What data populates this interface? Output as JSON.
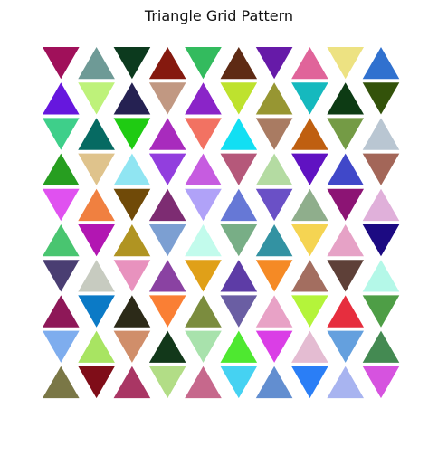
{
  "chart_data": {
    "type": "other",
    "title": "Triangle Grid Pattern",
    "grid": false,
    "axes_visible": false,
    "triangles": [
      {
        "row": 0,
        "col": 0,
        "orientation": "down",
        "color": "#a0105a"
      },
      {
        "row": 0,
        "col": 1,
        "orientation": "up",
        "color": "#6e9a96"
      },
      {
        "row": 0,
        "col": 2,
        "orientation": "down",
        "color": "#0c3a1e"
      },
      {
        "row": 0,
        "col": 3,
        "orientation": "up",
        "color": "#85190f"
      },
      {
        "row": 0,
        "col": 4,
        "orientation": "down",
        "color": "#33bb5e"
      },
      {
        "row": 0,
        "col": 5,
        "orientation": "up",
        "color": "#5e2a14"
      },
      {
        "row": 0,
        "col": 6,
        "orientation": "down",
        "color": "#661aa8"
      },
      {
        "row": 0,
        "col": 7,
        "orientation": "up",
        "color": "#e0649a"
      },
      {
        "row": 0,
        "col": 8,
        "orientation": "down",
        "color": "#ede282"
      },
      {
        "row": 0,
        "col": 9,
        "orientation": "up",
        "color": "#3071cf"
      },
      {
        "row": 1,
        "col": 0,
        "orientation": "up",
        "color": "#6617de"
      },
      {
        "row": 1,
        "col": 1,
        "orientation": "down",
        "color": "#bef27a"
      },
      {
        "row": 1,
        "col": 2,
        "orientation": "up",
        "color": "#252152"
      },
      {
        "row": 1,
        "col": 3,
        "orientation": "down",
        "color": "#c19882"
      },
      {
        "row": 1,
        "col": 4,
        "orientation": "up",
        "color": "#8a24c8"
      },
      {
        "row": 1,
        "col": 5,
        "orientation": "down",
        "color": "#bee22e"
      },
      {
        "row": 1,
        "col": 6,
        "orientation": "up",
        "color": "#979632"
      },
      {
        "row": 1,
        "col": 7,
        "orientation": "down",
        "color": "#15b9be"
      },
      {
        "row": 1,
        "col": 8,
        "orientation": "up",
        "color": "#0d3b14"
      },
      {
        "row": 1,
        "col": 9,
        "orientation": "down",
        "color": "#33520a"
      },
      {
        "row": 2,
        "col": 0,
        "orientation": "down",
        "color": "#3ecf8a"
      },
      {
        "row": 2,
        "col": 1,
        "orientation": "up",
        "color": "#066a62"
      },
      {
        "row": 2,
        "col": 2,
        "orientation": "down",
        "color": "#1fcb12"
      },
      {
        "row": 2,
        "col": 3,
        "orientation": "up",
        "color": "#a82bbd"
      },
      {
        "row": 2,
        "col": 4,
        "orientation": "down",
        "color": "#f27262"
      },
      {
        "row": 2,
        "col": 5,
        "orientation": "up",
        "color": "#12dff3"
      },
      {
        "row": 2,
        "col": 6,
        "orientation": "down",
        "color": "#a97b62"
      },
      {
        "row": 2,
        "col": 7,
        "orientation": "up",
        "color": "#bf5f10"
      },
      {
        "row": 2,
        "col": 8,
        "orientation": "down",
        "color": "#749b45"
      },
      {
        "row": 2,
        "col": 9,
        "orientation": "up",
        "color": "#b9c6d2"
      },
      {
        "row": 3,
        "col": 0,
        "orientation": "up",
        "color": "#279e20"
      },
      {
        "row": 3,
        "col": 1,
        "orientation": "down",
        "color": "#dfc38c"
      },
      {
        "row": 3,
        "col": 2,
        "orientation": "up",
        "color": "#90e5f2"
      },
      {
        "row": 3,
        "col": 3,
        "orientation": "down",
        "color": "#923ede"
      },
      {
        "row": 3,
        "col": 4,
        "orientation": "up",
        "color": "#c65ce0"
      },
      {
        "row": 3,
        "col": 5,
        "orientation": "down",
        "color": "#b5587a"
      },
      {
        "row": 3,
        "col": 6,
        "orientation": "up",
        "color": "#b4dba2"
      },
      {
        "row": 3,
        "col": 7,
        "orientation": "down",
        "color": "#6012c2"
      },
      {
        "row": 3,
        "col": 8,
        "orientation": "up",
        "color": "#4048c9"
      },
      {
        "row": 3,
        "col": 9,
        "orientation": "down",
        "color": "#a36658"
      },
      {
        "row": 4,
        "col": 0,
        "orientation": "down",
        "color": "#e051f0"
      },
      {
        "row": 4,
        "col": 1,
        "orientation": "up",
        "color": "#f08040"
      },
      {
        "row": 4,
        "col": 2,
        "orientation": "down",
        "color": "#704a08"
      },
      {
        "row": 4,
        "col": 3,
        "orientation": "up",
        "color": "#7d2c72"
      },
      {
        "row": 4,
        "col": 4,
        "orientation": "down",
        "color": "#b0a2f8"
      },
      {
        "row": 4,
        "col": 5,
        "orientation": "up",
        "color": "#6678d6"
      },
      {
        "row": 4,
        "col": 6,
        "orientation": "down",
        "color": "#6a50c6"
      },
      {
        "row": 4,
        "col": 7,
        "orientation": "up",
        "color": "#8fae8c"
      },
      {
        "row": 4,
        "col": 8,
        "orientation": "down",
        "color": "#8c1474"
      },
      {
        "row": 4,
        "col": 9,
        "orientation": "up",
        "color": "#e0b0da"
      },
      {
        "row": 5,
        "col": 0,
        "orientation": "up",
        "color": "#49c570"
      },
      {
        "row": 5,
        "col": 1,
        "orientation": "down",
        "color": "#b216b2"
      },
      {
        "row": 5,
        "col": 2,
        "orientation": "up",
        "color": "#b09422"
      },
      {
        "row": 5,
        "col": 3,
        "orientation": "down",
        "color": "#7c9fd2"
      },
      {
        "row": 5,
        "col": 4,
        "orientation": "up",
        "color": "#c2fbec"
      },
      {
        "row": 5,
        "col": 5,
        "orientation": "down",
        "color": "#78ae86"
      },
      {
        "row": 5,
        "col": 6,
        "orientation": "up",
        "color": "#3392a2"
      },
      {
        "row": 5,
        "col": 7,
        "orientation": "down",
        "color": "#f5d452"
      },
      {
        "row": 5,
        "col": 8,
        "orientation": "up",
        "color": "#e6a2c6"
      },
      {
        "row": 5,
        "col": 9,
        "orientation": "down",
        "color": "#1c0a82"
      },
      {
        "row": 6,
        "col": 0,
        "orientation": "down",
        "color": "#4a3e72"
      },
      {
        "row": 6,
        "col": 1,
        "orientation": "up",
        "color": "#c7cbc0"
      },
      {
        "row": 6,
        "col": 2,
        "orientation": "down",
        "color": "#e892be"
      },
      {
        "row": 6,
        "col": 3,
        "orientation": "up",
        "color": "#8a42a2"
      },
      {
        "row": 6,
        "col": 4,
        "orientation": "down",
        "color": "#e0a018"
      },
      {
        "row": 6,
        "col": 5,
        "orientation": "up",
        "color": "#5d3ca6"
      },
      {
        "row": 6,
        "col": 6,
        "orientation": "down",
        "color": "#f58a25"
      },
      {
        "row": 6,
        "col": 7,
        "orientation": "up",
        "color": "#a36e60"
      },
      {
        "row": 6,
        "col": 8,
        "orientation": "down",
        "color": "#5e4038"
      },
      {
        "row": 6,
        "col": 9,
        "orientation": "up",
        "color": "#b4f8e8"
      },
      {
        "row": 7,
        "col": 0,
        "orientation": "up",
        "color": "#8e1858"
      },
      {
        "row": 7,
        "col": 1,
        "orientation": "down",
        "color": "#0b7ac6"
      },
      {
        "row": 7,
        "col": 2,
        "orientation": "up",
        "color": "#2c2a18"
      },
      {
        "row": 7,
        "col": 3,
        "orientation": "down",
        "color": "#fa7f34"
      },
      {
        "row": 7,
        "col": 4,
        "orientation": "up",
        "color": "#7b8c3e"
      },
      {
        "row": 7,
        "col": 5,
        "orientation": "down",
        "color": "#6a5ea3"
      },
      {
        "row": 7,
        "col": 6,
        "orientation": "up",
        "color": "#e8a2c6"
      },
      {
        "row": 7,
        "col": 7,
        "orientation": "down",
        "color": "#b4f43a"
      },
      {
        "row": 7,
        "col": 8,
        "orientation": "up",
        "color": "#e62e3e"
      },
      {
        "row": 7,
        "col": 9,
        "orientation": "down",
        "color": "#4e9e46"
      },
      {
        "row": 8,
        "col": 0,
        "orientation": "down",
        "color": "#7eadee"
      },
      {
        "row": 8,
        "col": 1,
        "orientation": "up",
        "color": "#a8e462"
      },
      {
        "row": 8,
        "col": 2,
        "orientation": "down",
        "color": "#d08e6a"
      },
      {
        "row": 8,
        "col": 3,
        "orientation": "up",
        "color": "#12381a"
      },
      {
        "row": 8,
        "col": 4,
        "orientation": "down",
        "color": "#a8e2ac"
      },
      {
        "row": 8,
        "col": 5,
        "orientation": "up",
        "color": "#4ee830"
      },
      {
        "row": 8,
        "col": 6,
        "orientation": "down",
        "color": "#da3ee6"
      },
      {
        "row": 8,
        "col": 7,
        "orientation": "up",
        "color": "#e4bcd2"
      },
      {
        "row": 8,
        "col": 8,
        "orientation": "down",
        "color": "#64a0de"
      },
      {
        "row": 8,
        "col": 9,
        "orientation": "up",
        "color": "#448a52"
      },
      {
        "row": 9,
        "col": 0,
        "orientation": "up",
        "color": "#7a7746"
      },
      {
        "row": 9,
        "col": 1,
        "orientation": "down",
        "color": "#7f0d18"
      },
      {
        "row": 9,
        "col": 2,
        "orientation": "up",
        "color": "#a93664"
      },
      {
        "row": 9,
        "col": 3,
        "orientation": "down",
        "color": "#b2dd86"
      },
      {
        "row": 9,
        "col": 4,
        "orientation": "up",
        "color": "#c6688c"
      },
      {
        "row": 9,
        "col": 5,
        "orientation": "down",
        "color": "#45d2f2"
      },
      {
        "row": 9,
        "col": 6,
        "orientation": "up",
        "color": "#628ed0"
      },
      {
        "row": 9,
        "col": 7,
        "orientation": "down",
        "color": "#2a7ef6"
      },
      {
        "row": 9,
        "col": 8,
        "orientation": "up",
        "color": "#a8b4f0"
      },
      {
        "row": 9,
        "col": 9,
        "orientation": "down",
        "color": "#d653df"
      }
    ]
  }
}
